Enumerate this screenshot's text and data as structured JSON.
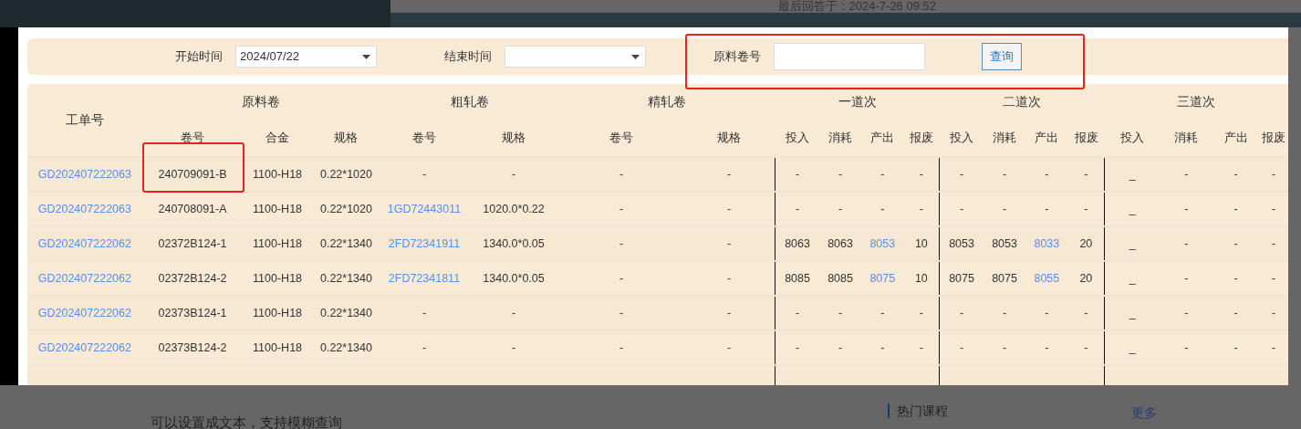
{
  "page_header": {
    "last_answer": "最后回答于：2024-7-26 09:52"
  },
  "filter": {
    "start_label": "开始时间",
    "start_value": "2024/07/22",
    "end_label": "结束时间",
    "coil_label": "原料卷号",
    "coil_highlighted": true,
    "query_button": "查询"
  },
  "table": {
    "group_headers": [
      "原料卷",
      "粗轧卷",
      "精轧卷",
      "一道次",
      "二道次",
      "三道次"
    ],
    "columns": [
      "工单号",
      "卷号",
      "合金",
      "规格",
      "卷号",
      "规格",
      "卷号",
      "规格",
      "投入",
      "消耗",
      "产出",
      "报废",
      "投入",
      "消耗",
      "产出",
      "报废",
      "投入",
      "消耗",
      "产出",
      "报废"
    ],
    "rows": [
      {
        "cells": [
          {
            "text": "GD202407222063",
            "kind": "link"
          },
          {
            "text": "240709091-B",
            "kind": "text",
            "highlighted": true
          },
          {
            "text": "1100-H18",
            "kind": "text"
          },
          {
            "text": "0.22*1020",
            "kind": "text"
          },
          {
            "text": "-",
            "kind": "text"
          },
          {
            "text": "-",
            "kind": "text"
          },
          {
            "text": "-",
            "kind": "text"
          },
          {
            "text": "-",
            "kind": "text"
          },
          {
            "text": "-",
            "kind": "text"
          },
          {
            "text": "-",
            "kind": "text"
          },
          {
            "text": "-",
            "kind": "text"
          },
          {
            "text": "-",
            "kind": "text"
          },
          {
            "text": "-",
            "kind": "text"
          },
          {
            "text": "-",
            "kind": "text"
          },
          {
            "text": "-",
            "kind": "text"
          },
          {
            "text": "-",
            "kind": "text"
          },
          {
            "text": "_",
            "kind": "text"
          },
          {
            "text": "-",
            "kind": "text"
          },
          {
            "text": "-",
            "kind": "text"
          },
          {
            "text": "-",
            "kind": "text"
          }
        ]
      },
      {
        "cells": [
          {
            "text": "GD202407222063",
            "kind": "link"
          },
          {
            "text": "240708091-A",
            "kind": "text"
          },
          {
            "text": "1100-H18",
            "kind": "text"
          },
          {
            "text": "0.22*1020",
            "kind": "text"
          },
          {
            "text": "1GD72443011",
            "kind": "link"
          },
          {
            "text": "1020.0*0.22",
            "kind": "text"
          },
          {
            "text": "-",
            "kind": "text"
          },
          {
            "text": "-",
            "kind": "text"
          },
          {
            "text": "-",
            "kind": "text"
          },
          {
            "text": "-",
            "kind": "text"
          },
          {
            "text": "-",
            "kind": "text"
          },
          {
            "text": "-",
            "kind": "text"
          },
          {
            "text": "-",
            "kind": "text"
          },
          {
            "text": "-",
            "kind": "text"
          },
          {
            "text": "-",
            "kind": "text"
          },
          {
            "text": "-",
            "kind": "text"
          },
          {
            "text": "_",
            "kind": "text"
          },
          {
            "text": "-",
            "kind": "text"
          },
          {
            "text": "-",
            "kind": "text"
          },
          {
            "text": "-",
            "kind": "text"
          }
        ]
      },
      {
        "cells": [
          {
            "text": "GD202407222062",
            "kind": "link"
          },
          {
            "text": "02372B124-1",
            "kind": "text"
          },
          {
            "text": "1100-H18",
            "kind": "text"
          },
          {
            "text": "0.22*1340",
            "kind": "text"
          },
          {
            "text": "2FD72341911",
            "kind": "link"
          },
          {
            "text": "1340.0*0.05",
            "kind": "text"
          },
          {
            "text": "-",
            "kind": "text"
          },
          {
            "text": "-",
            "kind": "text"
          },
          {
            "text": "8063",
            "kind": "text"
          },
          {
            "text": "8063",
            "kind": "text"
          },
          {
            "text": "8053",
            "kind": "link"
          },
          {
            "text": "10",
            "kind": "text"
          },
          {
            "text": "8053",
            "kind": "text"
          },
          {
            "text": "8053",
            "kind": "text"
          },
          {
            "text": "8033",
            "kind": "link"
          },
          {
            "text": "20",
            "kind": "text"
          },
          {
            "text": "_",
            "kind": "text"
          },
          {
            "text": "-",
            "kind": "text"
          },
          {
            "text": "-",
            "kind": "text"
          },
          {
            "text": "-",
            "kind": "text"
          }
        ]
      },
      {
        "cells": [
          {
            "text": "GD202407222062",
            "kind": "link"
          },
          {
            "text": "02372B124-2",
            "kind": "text"
          },
          {
            "text": "1100-H18",
            "kind": "text"
          },
          {
            "text": "0.22*1340",
            "kind": "text"
          },
          {
            "text": "2FD72341811",
            "kind": "link"
          },
          {
            "text": "1340.0*0.05",
            "kind": "text"
          },
          {
            "text": "-",
            "kind": "text"
          },
          {
            "text": "-",
            "kind": "text"
          },
          {
            "text": "8085",
            "kind": "text"
          },
          {
            "text": "8085",
            "kind": "text"
          },
          {
            "text": "8075",
            "kind": "link"
          },
          {
            "text": "10",
            "kind": "text"
          },
          {
            "text": "8075",
            "kind": "text"
          },
          {
            "text": "8075",
            "kind": "text"
          },
          {
            "text": "8055",
            "kind": "link"
          },
          {
            "text": "20",
            "kind": "text"
          },
          {
            "text": "_",
            "kind": "text"
          },
          {
            "text": "-",
            "kind": "text"
          },
          {
            "text": "-",
            "kind": "text"
          },
          {
            "text": "-",
            "kind": "text"
          }
        ]
      },
      {
        "cells": [
          {
            "text": "GD202407222062",
            "kind": "link"
          },
          {
            "text": "02373B124-1",
            "kind": "text"
          },
          {
            "text": "1100-H18",
            "kind": "text"
          },
          {
            "text": "0.22*1340",
            "kind": "text"
          },
          {
            "text": "-",
            "kind": "text"
          },
          {
            "text": "-",
            "kind": "text"
          },
          {
            "text": "-",
            "kind": "text"
          },
          {
            "text": "-",
            "kind": "text"
          },
          {
            "text": "-",
            "kind": "text"
          },
          {
            "text": "-",
            "kind": "text"
          },
          {
            "text": "-",
            "kind": "text"
          },
          {
            "text": "-",
            "kind": "text"
          },
          {
            "text": "-",
            "kind": "text"
          },
          {
            "text": "-",
            "kind": "text"
          },
          {
            "text": "-",
            "kind": "text"
          },
          {
            "text": "-",
            "kind": "text"
          },
          {
            "text": "_",
            "kind": "text"
          },
          {
            "text": "-",
            "kind": "text"
          },
          {
            "text": "-",
            "kind": "text"
          },
          {
            "text": "-",
            "kind": "text"
          }
        ]
      },
      {
        "cells": [
          {
            "text": "GD202407222062",
            "kind": "link"
          },
          {
            "text": "02373B124-2",
            "kind": "text"
          },
          {
            "text": "1100-H18",
            "kind": "text"
          },
          {
            "text": "0.22*1340",
            "kind": "text"
          },
          {
            "text": "-",
            "kind": "text"
          },
          {
            "text": "-",
            "kind": "text"
          },
          {
            "text": "-",
            "kind": "text"
          },
          {
            "text": "-",
            "kind": "text"
          },
          {
            "text": "-",
            "kind": "text"
          },
          {
            "text": "-",
            "kind": "text"
          },
          {
            "text": "-",
            "kind": "text"
          },
          {
            "text": "-",
            "kind": "text"
          },
          {
            "text": "-",
            "kind": "text"
          },
          {
            "text": "-",
            "kind": "text"
          },
          {
            "text": "-",
            "kind": "text"
          },
          {
            "text": "-",
            "kind": "text"
          },
          {
            "text": "_",
            "kind": "text"
          },
          {
            "text": "-",
            "kind": "text"
          },
          {
            "text": "-",
            "kind": "text"
          },
          {
            "text": "-",
            "kind": "text"
          }
        ]
      }
    ]
  },
  "comment": {
    "text": "可以设置成文本，支持模糊查询"
  },
  "sidebar": {
    "title": "热门课程",
    "more_link": "更多"
  }
}
